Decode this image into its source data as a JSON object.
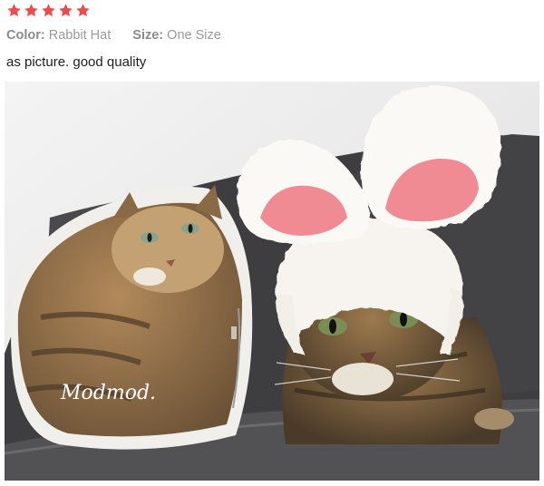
{
  "review": {
    "rating": 5,
    "rating_max": 5,
    "star_color": "#ef4b4b",
    "color_label": "Color:",
    "color_value": "Rabbit Hat",
    "size_label": "Size:",
    "size_value": "One Size",
    "text": "as picture. good quality",
    "photo": {
      "pillow_brand": "Modmod."
    }
  }
}
